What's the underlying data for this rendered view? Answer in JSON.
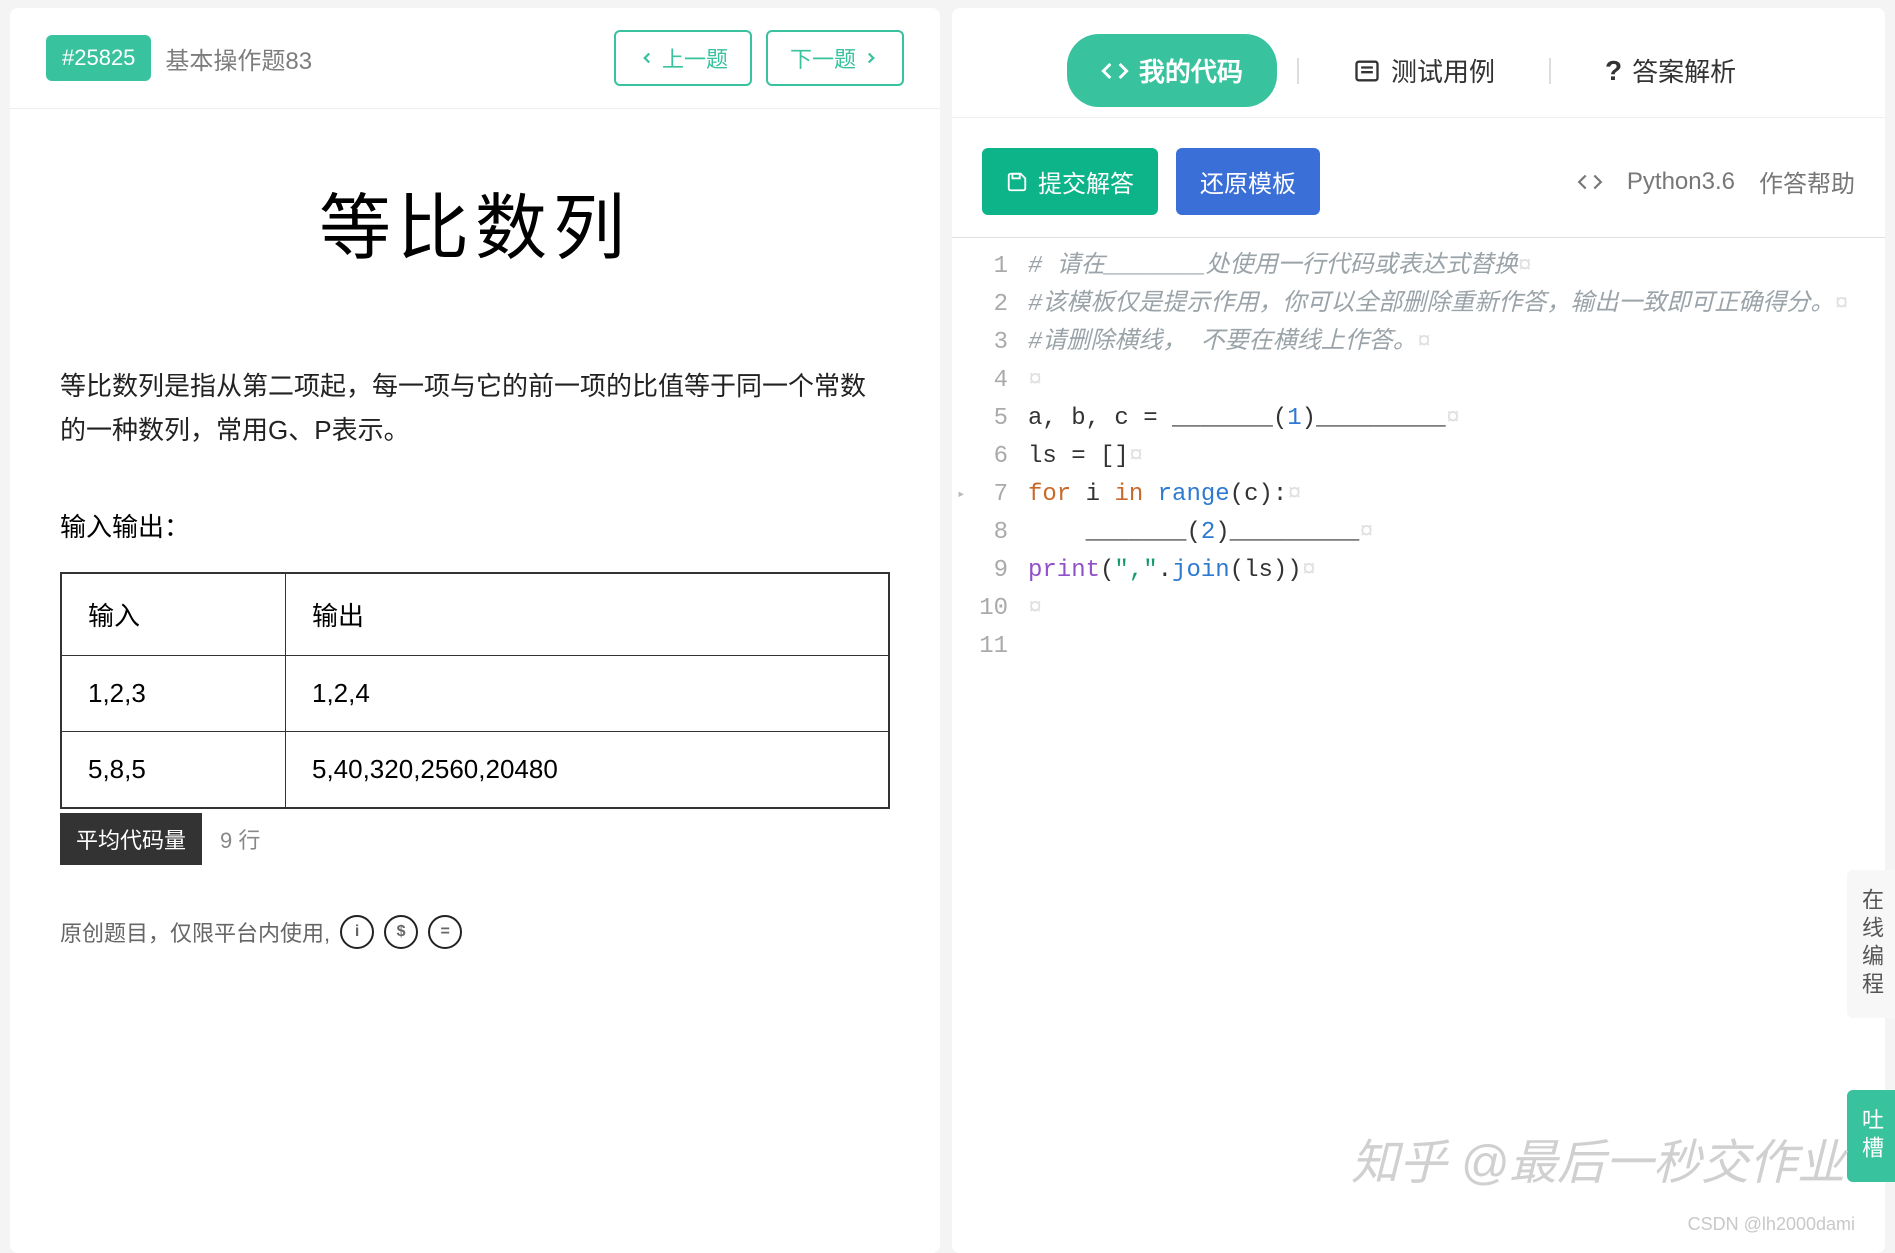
{
  "problem": {
    "id": "#25825",
    "title_short": "基本操作题83",
    "title_big": "等比数列",
    "description": "等比数列是指从第二项起，每一项与它的前一项的比值等于同一个常数的一种数列，常用G、P表示。",
    "io_label": "输入输出：",
    "headers": {
      "in": "输入",
      "out": "输出"
    },
    "rows": [
      {
        "in": "1,2,3",
        "out": "1,2,4"
      },
      {
        "in": "5,8,5",
        "out": "5,40,320,2560,20480"
      }
    ],
    "avg_label": "平均代码量",
    "avg_value": "9 行",
    "notice": "原创题目，仅限平台内使用,"
  },
  "nav": {
    "prev": "上一题",
    "next": "下一题"
  },
  "tabs": {
    "code": "我的代码",
    "test": "测试用例",
    "answer": "答案解析"
  },
  "toolbar": {
    "submit": "提交解答",
    "reset": "还原模板",
    "lang": "Python3.6",
    "help": "作答帮助"
  },
  "editor": {
    "lines": [
      {
        "n": 1,
        "tokens": [
          [
            "tok-comment",
            "# 请在_______处使用一行代码或表达式替换"
          ],
          [
            "nbspchar",
            "¤"
          ]
        ]
      },
      {
        "n": 2,
        "tokens": [
          [
            "tok-comment",
            "#该模板仅是提示作用，你可以全部删除重新作答，输出一致即可正确得分。"
          ],
          [
            "nbspchar",
            "¤"
          ]
        ]
      },
      {
        "n": 3,
        "tokens": [
          [
            "tok-comment",
            "#请删除横线， 不要在横线上作答。"
          ],
          [
            "nbspchar",
            "¤"
          ]
        ]
      },
      {
        "n": 4,
        "tokens": [
          [
            "nbspchar",
            "¤"
          ]
        ]
      },
      {
        "n": 5,
        "tokens": [
          [
            "tok-id",
            "a, b, c "
          ],
          [
            "tok-op",
            "= "
          ],
          [
            "tok-id",
            "_______"
          ],
          [
            "tok-op",
            "("
          ],
          [
            "tok-num",
            "1"
          ],
          [
            "tok-op",
            ")"
          ],
          [
            "tok-id",
            "_________"
          ],
          [
            "nbspchar",
            "¤"
          ]
        ]
      },
      {
        "n": 6,
        "tokens": [
          [
            "tok-id",
            "ls "
          ],
          [
            "tok-op",
            "= []"
          ],
          [
            "nbspchar",
            "¤"
          ]
        ]
      },
      {
        "n": 7,
        "fold": true,
        "tokens": [
          [
            "tok-kw",
            "for"
          ],
          [
            "tok-id",
            " i "
          ],
          [
            "tok-kw",
            "in"
          ],
          [
            "tok-id",
            " "
          ],
          [
            "tok-fn",
            "range"
          ],
          [
            "tok-op",
            "("
          ],
          [
            "tok-id",
            "c"
          ],
          [
            "tok-op",
            ")"
          ],
          [
            "tok-op",
            ":"
          ],
          [
            "nbspchar",
            "¤"
          ]
        ]
      },
      {
        "n": 8,
        "tokens": [
          [
            "tok-id",
            "    _______"
          ],
          [
            "tok-op",
            "("
          ],
          [
            "tok-num",
            "2"
          ],
          [
            "tok-op",
            ")"
          ],
          [
            "tok-id",
            "_________"
          ],
          [
            "nbspchar",
            "¤"
          ]
        ]
      },
      {
        "n": 9,
        "tokens": [
          [
            "tok-kw2",
            "print"
          ],
          [
            "tok-op",
            "("
          ],
          [
            "tok-str",
            "\",\""
          ],
          [
            "tok-op",
            "."
          ],
          [
            "tok-fn",
            "join"
          ],
          [
            "tok-op",
            "("
          ],
          [
            "tok-id",
            "ls"
          ],
          [
            "tok-op",
            "))"
          ],
          [
            "nbspchar",
            "¤"
          ]
        ]
      },
      {
        "n": 10,
        "tokens": [
          [
            "nbspchar",
            "¤"
          ]
        ]
      },
      {
        "n": 11,
        "tokens": []
      }
    ]
  },
  "sidefloat": {
    "a": "在线编程",
    "b": "吐槽"
  },
  "watermark": "知乎 @最后一秒交作业",
  "credit": "CSDN @lh2000dami"
}
